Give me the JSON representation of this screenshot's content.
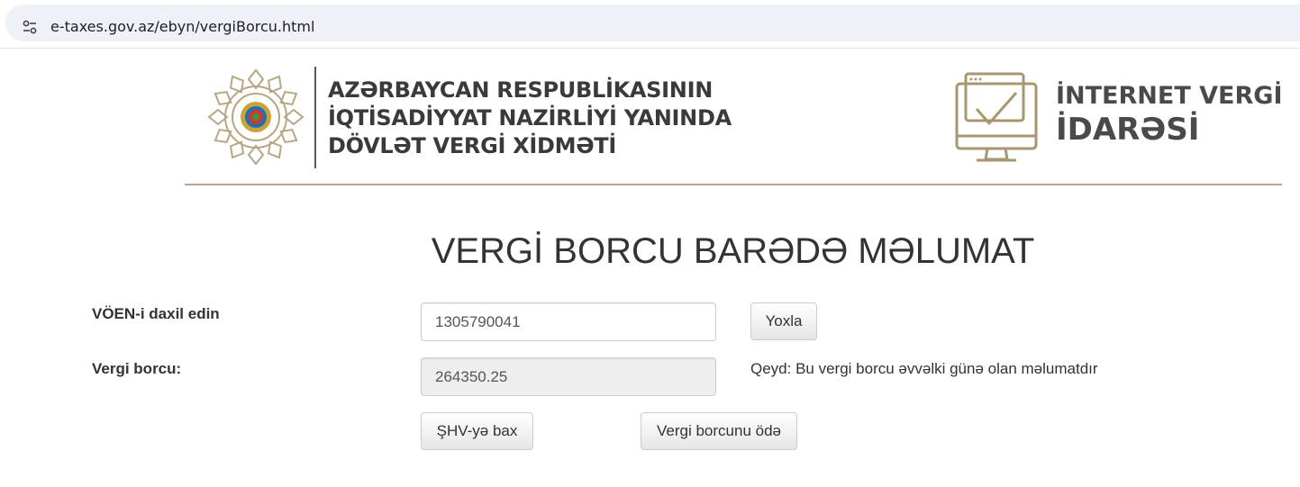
{
  "browser": {
    "url": "e-taxes.gov.az/ebyn/vergiBorcu.html",
    "site_info_icon": "tune-icon"
  },
  "header": {
    "org_name_lines": [
      "AZƏRBAYCAN RESPUBLİKASININ",
      "İQTİSADİYYAT NAZİRLİYİ YANINDA",
      "DÖVLƏT VERGİ XİDMƏTİ"
    ],
    "service_name_lines": [
      "İNTERNET VERGİ",
      "İDARƏSİ"
    ],
    "emblem_icon": "state-emblem-icon",
    "service_icon": "computer-checkmark-icon",
    "accent_color": "#b6a98a"
  },
  "form": {
    "title": "VERGİ BORCU BARƏDƏ MƏLUMAT",
    "voen_label": "VÖEN-i daxil edin",
    "voen_value": "1305790041",
    "check_button": "Yoxla",
    "debt_label": "Vergi borcu:",
    "debt_value": "264350.25",
    "note": "Qeyd: Bu vergi borcu əvvəlki günə olan məlumatdır",
    "shv_button": "ŞHV-yə bax",
    "pay_button": "Vergi borcunu ödə"
  }
}
